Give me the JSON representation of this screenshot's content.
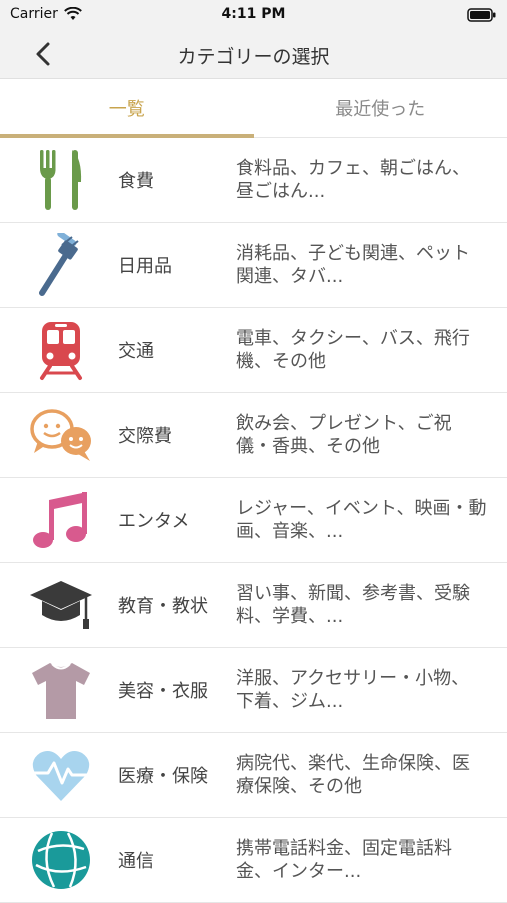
{
  "status": {
    "carrier": "Carrier",
    "time": "4:11 PM"
  },
  "nav": {
    "title": "カテゴリーの選択"
  },
  "tabs": [
    {
      "label": "一覧"
    },
    {
      "label": "最近使った"
    }
  ],
  "categories": [
    {
      "name": "食費",
      "desc": "食料品、カフェ、朝ごはん、昼ごはん...",
      "icon": "fork-knife-icon",
      "color": "#6a9a4a"
    },
    {
      "name": "日用品",
      "desc": "消耗品、子ども関連、ペット関連、タバ...",
      "icon": "toothbrush-icon",
      "color": "#4a6a8e"
    },
    {
      "name": "交通",
      "desc": "電車、タクシー、バス、飛行機、その他",
      "icon": "train-icon",
      "color": "#d9484e"
    },
    {
      "name": "交際費",
      "desc": "飲み会、プレゼント、ご祝儀・香典、その他",
      "icon": "chat-faces-icon",
      "color": "#e8a060"
    },
    {
      "name": "エンタメ",
      "desc": "レジャー、イベント、映画・動画、音楽、...",
      "icon": "music-note-icon",
      "color": "#d85a8e"
    },
    {
      "name": "教育・教状",
      "desc": "習い事、新聞、参考書、受験料、学費、...",
      "icon": "graduation-cap-icon",
      "color": "#3a3a3a"
    },
    {
      "name": "美容・衣服",
      "desc": "洋服、アクセサリー・小物、下着、ジム...",
      "icon": "tshirt-icon",
      "color": "#b49aa6"
    },
    {
      "name": "医療・保険",
      "desc": "病院代、楽代、生命保険、医療保険、その他",
      "icon": "heart-pulse-icon",
      "color": "#a8d4ee"
    },
    {
      "name": "通信",
      "desc": "携帯電話料金、固定電話料金、インター...",
      "icon": "globe-icon",
      "color": "#1a9a9a"
    }
  ]
}
